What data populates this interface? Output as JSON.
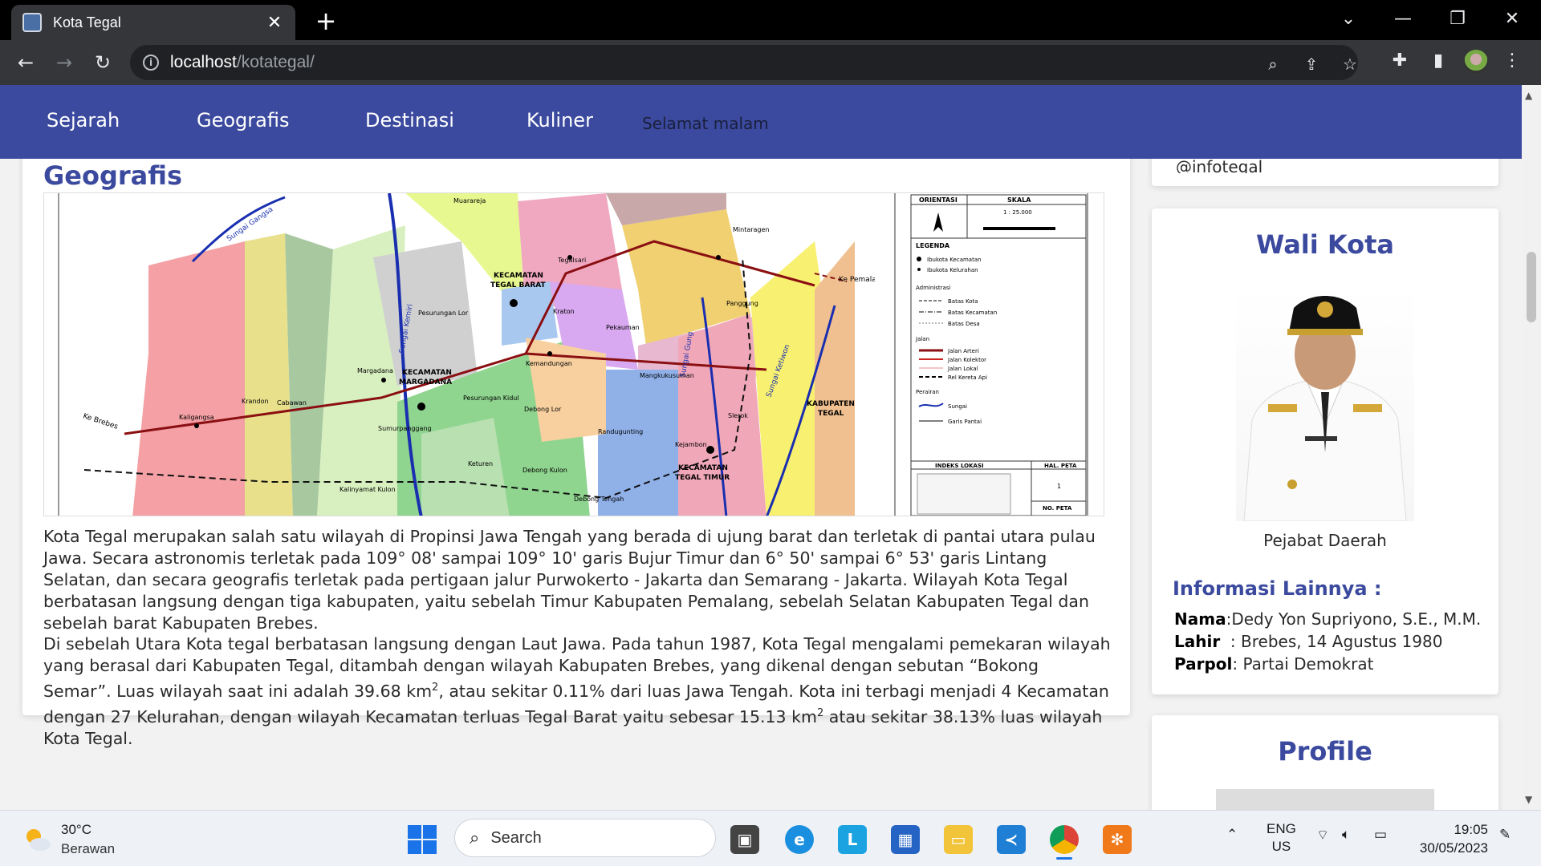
{
  "browser": {
    "tab_title": "Kota Tegal",
    "tab_close": "✕",
    "new_tab": "+",
    "url_host": "localhost",
    "url_path": "/kotategal/"
  },
  "nav": {
    "items": [
      "Sejarah",
      "Geografis",
      "Destinasi",
      "Kuliner"
    ],
    "greeting": "Selamat malam"
  },
  "main": {
    "title": "Geografis",
    "map": {
      "orientasi": "ORIENTASI",
      "skala": "SKALA",
      "scale_value": "1 : 25.000",
      "legenda": "LEGENDA",
      "legend_items": [
        "Ibukota Kecamatan",
        "Ibukota Kelurahan",
        "Administrasi",
        "Batas Kota",
        "Batas Kecamatan",
        "Batas Desa",
        "Jalan",
        "Jalan Arteri",
        "Jalan Kolektor",
        "Jalan Lokal",
        "Rel Kereta Api",
        "Perairan",
        "Sungai",
        "Garis Pantai"
      ],
      "indeks_lokasi": "INDEKS LOKASI",
      "hal_peta": "HAL. PETA",
      "hal_num": "1",
      "no_peta": "NO. PETA",
      "labels": [
        "KECAMATAN TEGAL BARAT",
        "KECAMATAN MARGADANA",
        "KECAMATAN TEGAL TIMUR",
        "KABUPATEN TEGAL",
        "Ke Pemalang",
        "Ke Brebes",
        "Sungai Gangsa",
        "Sungai Kemiri",
        "Sungai Gung",
        "Sungai Ketiwon",
        "Muarareja",
        "Tegalsari",
        "Mintaragen",
        "Kraton",
        "Pekauman",
        "Panggung",
        "Pesurungan Lor",
        "Margadana",
        "Kemandungan",
        "Mangkukusuman",
        "Kaligangsa",
        "Krandon",
        "Cabawan",
        "Pesurungan Kidul",
        "Debong Lor",
        "Slerok",
        "Sumurpanggang",
        "Randugunting",
        "Kejambon",
        "Keturen",
        "Debong Kulon",
        "Kalinyamat Kulon",
        "Debong Tengah"
      ]
    },
    "para1": "Kota Tegal merupakan salah satu wilayah di Propinsi Jawa Tengah yang berada di ujung barat dan terletak di pantai utara pulau Jawa. Secara astronomis terletak pada 109° 08' sampai 109° 10' garis Bujur Timur dan 6° 50' sampai 6° 53' garis Lintang Selatan, dan secara geografis terletak pada pertigaan jalur Purwokerto - Jakarta dan Semarang - Jakarta. Wilayah Kota Tegal berbatasan langsung dengan tiga kabupaten, yaitu sebelah Timur Kabupaten Pemalang, sebelah Selatan Kabupaten Tegal dan sebelah barat Kabupaten Brebes.",
    "para2_a": "Di sebelah Utara Kota tegal berbatasan langsung dengan Laut Jawa. Pada tahun 1987, Kota Tegal mengalami pemekaran wilayah yang berasal dari Kabupaten Tegal, ditambah dengan wilayah Kabupaten Brebes, yang dikenal dengan sebutan “Bokong Semar”. Luas wilayah saat ini adalah 39.68 km",
    "para2_b": ", atau sekitar 0.11% dari luas Jawa Tengah. Kota ini terbagi menjadi 4 Kecamatan dengan 27 Kelurahan, dengan wilayah Kecamatan terluas Tegal Barat yaitu sebesar 15.13 km",
    "para2_c": " atau sekitar 38.13% luas wilayah Kota Tegal.",
    "sup": "2"
  },
  "sidebar": {
    "top_card_text": "@infotegal",
    "wali_title": "Wali Kota",
    "portrait_caption": "Pejabat Daerah",
    "info_title": "Informasi Lainnya :",
    "info": [
      {
        "label": "Nama",
        "value": ":Dedy Yon Supriyono, S.E., M.M."
      },
      {
        "label": "Lahir",
        "value": "  : Brebes, 14 Agustus 1980"
      },
      {
        "label": "Parpol",
        "value": ": Partai Demokrat"
      }
    ],
    "profile_title": "Profile"
  },
  "taskbar": {
    "temp": "30°C",
    "weather": "Berawan",
    "search": "Search",
    "lang1": "ENG",
    "lang2": "US",
    "time": "19:05",
    "date": "30/05/2023"
  },
  "colors": {
    "navbar": "#3b4a9e",
    "heading": "#3b4a9e"
  }
}
